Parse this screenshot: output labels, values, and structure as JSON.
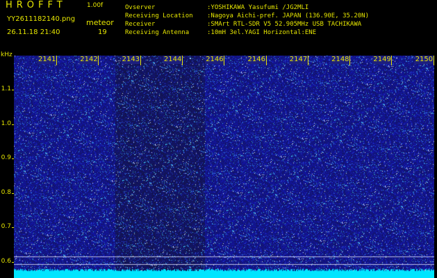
{
  "header": {
    "app_title": "HROFFT",
    "version": "1.00f",
    "filename": "YY2611182140.png",
    "datetime": "26.11.18 21:40",
    "meteor_label": "meteor",
    "meteor_count": "19"
  },
  "station": [
    {
      "label": "Ovserver",
      "value": ":YOSHIKAWA Yasufumi /JG2MLI"
    },
    {
      "label": "Receiving Location",
      "value": ":Nagoya Aichi-pref. JAPAN (136.90E, 35.20N)"
    },
    {
      "label": "Receiver",
      "value": ":SMArt RTL-SDR V5 52.905MHz USB TACHIKAWA"
    },
    {
      "label": "Receiving Antenna",
      "value": ":10mH 3el.YAGI Horizontal:ENE"
    }
  ],
  "y_axis": {
    "unit": "kHz",
    "ticks": [
      {
        "label": "1.1",
        "value": 1.1
      },
      {
        "label": "1.0",
        "value": 1.0
      },
      {
        "label": "0.9",
        "value": 0.9
      },
      {
        "label": "0.8",
        "value": 0.8
      },
      {
        "label": "0.7",
        "value": 0.7
      },
      {
        "label": "0.6",
        "value": 0.6
      }
    ]
  },
  "x_axis": {
    "ticks": [
      "2141",
      "2142",
      "2143",
      "2144",
      "2146",
      "2146",
      "2147",
      "2148",
      "2149",
      "2150"
    ]
  },
  "colors": {
    "text": "#e6e600",
    "background": "#000000",
    "spectrogram_base": "#1d1f7e",
    "noise_band": "#00e5ff"
  }
}
